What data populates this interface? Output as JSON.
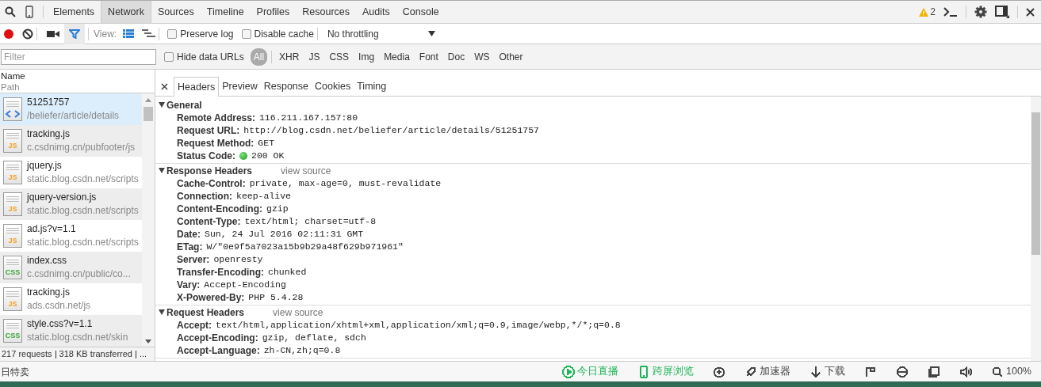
{
  "main_tabs": [
    {
      "label": "Elements",
      "selected": false
    },
    {
      "label": "Network",
      "selected": true
    },
    {
      "label": "Sources",
      "selected": false
    },
    {
      "label": "Timeline",
      "selected": false
    },
    {
      "label": "Profiles",
      "selected": false
    },
    {
      "label": "Resources",
      "selected": false
    },
    {
      "label": "Audits",
      "selected": false
    },
    {
      "label": "Console",
      "selected": false
    }
  ],
  "warning_count": "2",
  "toolbar": {
    "recording": true,
    "filter_on": true,
    "view_label": "View:",
    "preserve_log": {
      "label": "Preserve log",
      "checked": false
    },
    "disable_cache": {
      "label": "Disable cache",
      "checked": false
    },
    "throttling": "No throttling"
  },
  "filter_bar": {
    "placeholder": "Filter",
    "hide_data_urls": {
      "label": "Hide data URLs",
      "checked": false
    },
    "types": [
      {
        "label": "All",
        "selected": true
      },
      {
        "label": "XHR",
        "selected": false
      },
      {
        "label": "JS",
        "selected": false
      },
      {
        "label": "CSS",
        "selected": false
      },
      {
        "label": "Img",
        "selected": false
      },
      {
        "label": "Media",
        "selected": false
      },
      {
        "label": "Font",
        "selected": false
      },
      {
        "label": "Doc",
        "selected": false
      },
      {
        "label": "WS",
        "selected": false
      },
      {
        "label": "Other",
        "selected": false
      }
    ]
  },
  "requests": {
    "columns": [
      "Name",
      "Path"
    ],
    "rows": [
      {
        "name": "51251757",
        "path": "/beliefer/article/details",
        "kind": "doc",
        "selected": true
      },
      {
        "name": "tracking.js",
        "path": "c.csdnimg.cn/pubfooter/js",
        "kind": "script",
        "badge": "JS",
        "selected": false
      },
      {
        "name": "jquery.js",
        "path": "static.blog.csdn.net/scripts",
        "kind": "script",
        "badge": "JS",
        "selected": false
      },
      {
        "name": "jquery-version.js",
        "path": "static.blog.csdn.net/scripts",
        "kind": "script",
        "badge": "JS",
        "selected": false
      },
      {
        "name": "ad.js?v=1.1",
        "path": "static.blog.csdn.net/scripts",
        "kind": "script",
        "badge": "JS",
        "selected": false
      },
      {
        "name": "index.css",
        "path": "c.csdnimg.cn/public/co...",
        "kind": "stylesheet",
        "badge": "CSS",
        "selected": false
      },
      {
        "name": "tracking.js",
        "path": "ads.csdn.net/js",
        "kind": "script",
        "badge": "JS",
        "selected": false
      },
      {
        "name": "style.css?v=1.1",
        "path": "static.blog.csdn.net/skin",
        "kind": "stylesheet",
        "badge": "CSS",
        "selected": false
      }
    ],
    "summary": [
      "217 requests",
      "318 KB transferred",
      "..."
    ]
  },
  "detail_tabs": [
    {
      "label": "Headers",
      "selected": true
    },
    {
      "label": "Preview",
      "selected": false
    },
    {
      "label": "Response",
      "selected": false
    },
    {
      "label": "Cookies",
      "selected": false
    },
    {
      "label": "Timing",
      "selected": false
    }
  ],
  "sections": [
    {
      "title": "General",
      "expanded": true,
      "headers": [
        {
          "name": "Remote Address:",
          "value": "116.211.167.157:80",
          "kind": "plain"
        },
        {
          "name": "Request URL:",
          "value": "http://blog.csdn.net/beliefer/article/details/51251757",
          "kind": "plain"
        },
        {
          "name": "Request Method:",
          "value": "GET",
          "kind": "plain"
        },
        {
          "name": "Status Code:",
          "value": "200 OK",
          "kind": "status"
        }
      ]
    },
    {
      "title": "Response Headers",
      "expanded": true,
      "link": "view source",
      "headers": [
        {
          "name": "Cache-Control:",
          "value": "private, max-age=0, must-revalidate",
          "kind": "plain"
        },
        {
          "name": "Connection:",
          "value": "keep-alive",
          "kind": "plain"
        },
        {
          "name": "Content-Encoding:",
          "value": "gzip",
          "kind": "plain"
        },
        {
          "name": "Content-Type:",
          "value": "text/html; charset=utf-8",
          "kind": "plain"
        },
        {
          "name": "Date:",
          "value": "Sun, 24 Jul 2016 02:11:31 GMT",
          "kind": "plain"
        },
        {
          "name": "ETag:",
          "value": "W/\"0e9f5a7023a15b9b29a48f629b971961\"",
          "kind": "plain"
        },
        {
          "name": "Server:",
          "value": "openresty",
          "kind": "plain"
        },
        {
          "name": "Transfer-Encoding:",
          "value": "chunked",
          "kind": "plain"
        },
        {
          "name": "Vary:",
          "value": "Accept-Encoding",
          "kind": "plain"
        },
        {
          "name": "X-Powered-By:",
          "value": "PHP 5.4.28",
          "kind": "plain"
        }
      ]
    },
    {
      "title": "Request Headers",
      "expanded": true,
      "link": "view source",
      "headers": [
        {
          "name": "Accept:",
          "value": "text/html,application/xhtml+xml,application/xml;q=0.9,image/webp,*/*;q=0.8",
          "kind": "plain"
        },
        {
          "name": "Accept-Encoding:",
          "value": "gzip, deflate, sdch",
          "kind": "plain"
        },
        {
          "name": "Accept-Language:",
          "value": "zh-CN,zh;q=0.8",
          "kind": "plain"
        }
      ]
    }
  ],
  "browser_status": {
    "left_text": "日特卖",
    "items": [
      {
        "kind": "live",
        "label": "今日直播",
        "color": "#1fb45a"
      },
      {
        "kind": "phone",
        "label": "跨屏浏览",
        "color": "#1fb45a"
      },
      {
        "kind": "clean",
        "color": "#444444"
      },
      {
        "kind": "rocket",
        "label": "加速器",
        "color": "#444444"
      },
      {
        "kind": "download",
        "label": "下载",
        "color": "#444444"
      },
      {
        "kind": "flag",
        "color": "#444444"
      },
      {
        "kind": "ie",
        "color": "#444444"
      },
      {
        "kind": "window",
        "color": "#444444"
      },
      {
        "kind": "sound",
        "color": "#444444"
      },
      {
        "kind": "zoom",
        "label": "100%",
        "color": "#444444"
      }
    ]
  }
}
